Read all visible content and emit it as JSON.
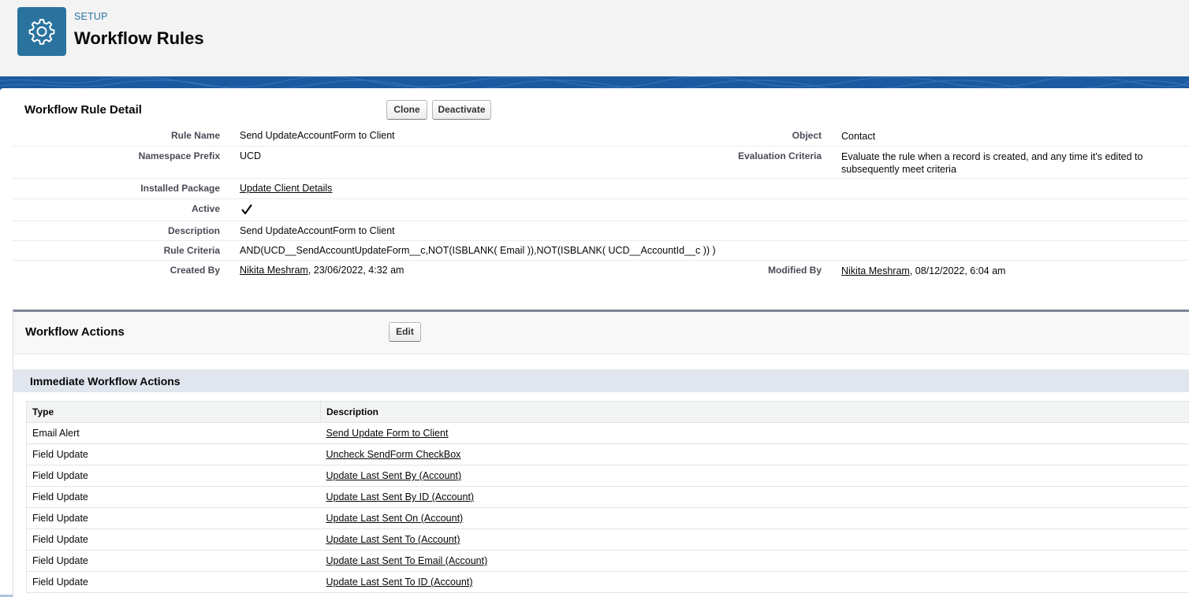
{
  "header": {
    "eyebrow": "SETUP",
    "title": "Workflow Rules",
    "icon": "gear-icon",
    "icon_bg": "#2a739e"
  },
  "detail": {
    "title": "Workflow Rule Detail",
    "buttons": {
      "clone": "Clone",
      "deactivate": "Deactivate"
    },
    "fields": {
      "rule_name_label": "Rule Name",
      "rule_name": "Send UpdateAccountForm to Client",
      "object_label": "Object",
      "object": "Contact",
      "namespace_label": "Namespace Prefix",
      "namespace": "UCD",
      "evaluation_label": "Evaluation Criteria",
      "evaluation": "Evaluate the rule when a record is created, and any time it's edited to subsequently meet criteria",
      "package_label": "Installed Package",
      "package": "Update Client Details",
      "active_label": "Active",
      "active_checked": true,
      "description_label": "Description",
      "description": "Send UpdateAccountForm to Client",
      "criteria_label": "Rule Criteria",
      "criteria": "AND(UCD__SendAccountUpdateForm__c,NOT(ISBLANK( Email )),NOT(ISBLANK( UCD__AccountId__c )) )",
      "created_label": "Created By",
      "created_user": "Nikita Meshram",
      "created_date": ", 23/06/2022, 4:32 am",
      "modified_label": "Modified By",
      "modified_user": "Nikita Meshram",
      "modified_date": ", 08/12/2022, 6:04 am"
    }
  },
  "actions": {
    "title": "Workflow Actions",
    "edit_label": "Edit",
    "immediate_title": "Immediate Workflow Actions",
    "columns": [
      "Type",
      "Description"
    ],
    "rows": [
      {
        "type": "Email Alert",
        "description": "Send Update Form to Client"
      },
      {
        "type": "Field Update",
        "description": "Uncheck SendForm CheckBox"
      },
      {
        "type": "Field Update",
        "description": "Update Last Sent By (Account)"
      },
      {
        "type": "Field Update",
        "description": "Update Last Sent By ID (Account)"
      },
      {
        "type": "Field Update",
        "description": "Update Last Sent On (Account)"
      },
      {
        "type": "Field Update",
        "description": "Update Last Sent To (Account)"
      },
      {
        "type": "Field Update",
        "description": "Update Last Sent To Email (Account)"
      },
      {
        "type": "Field Update",
        "description": "Update Last Sent To ID (Account)"
      }
    ]
  }
}
